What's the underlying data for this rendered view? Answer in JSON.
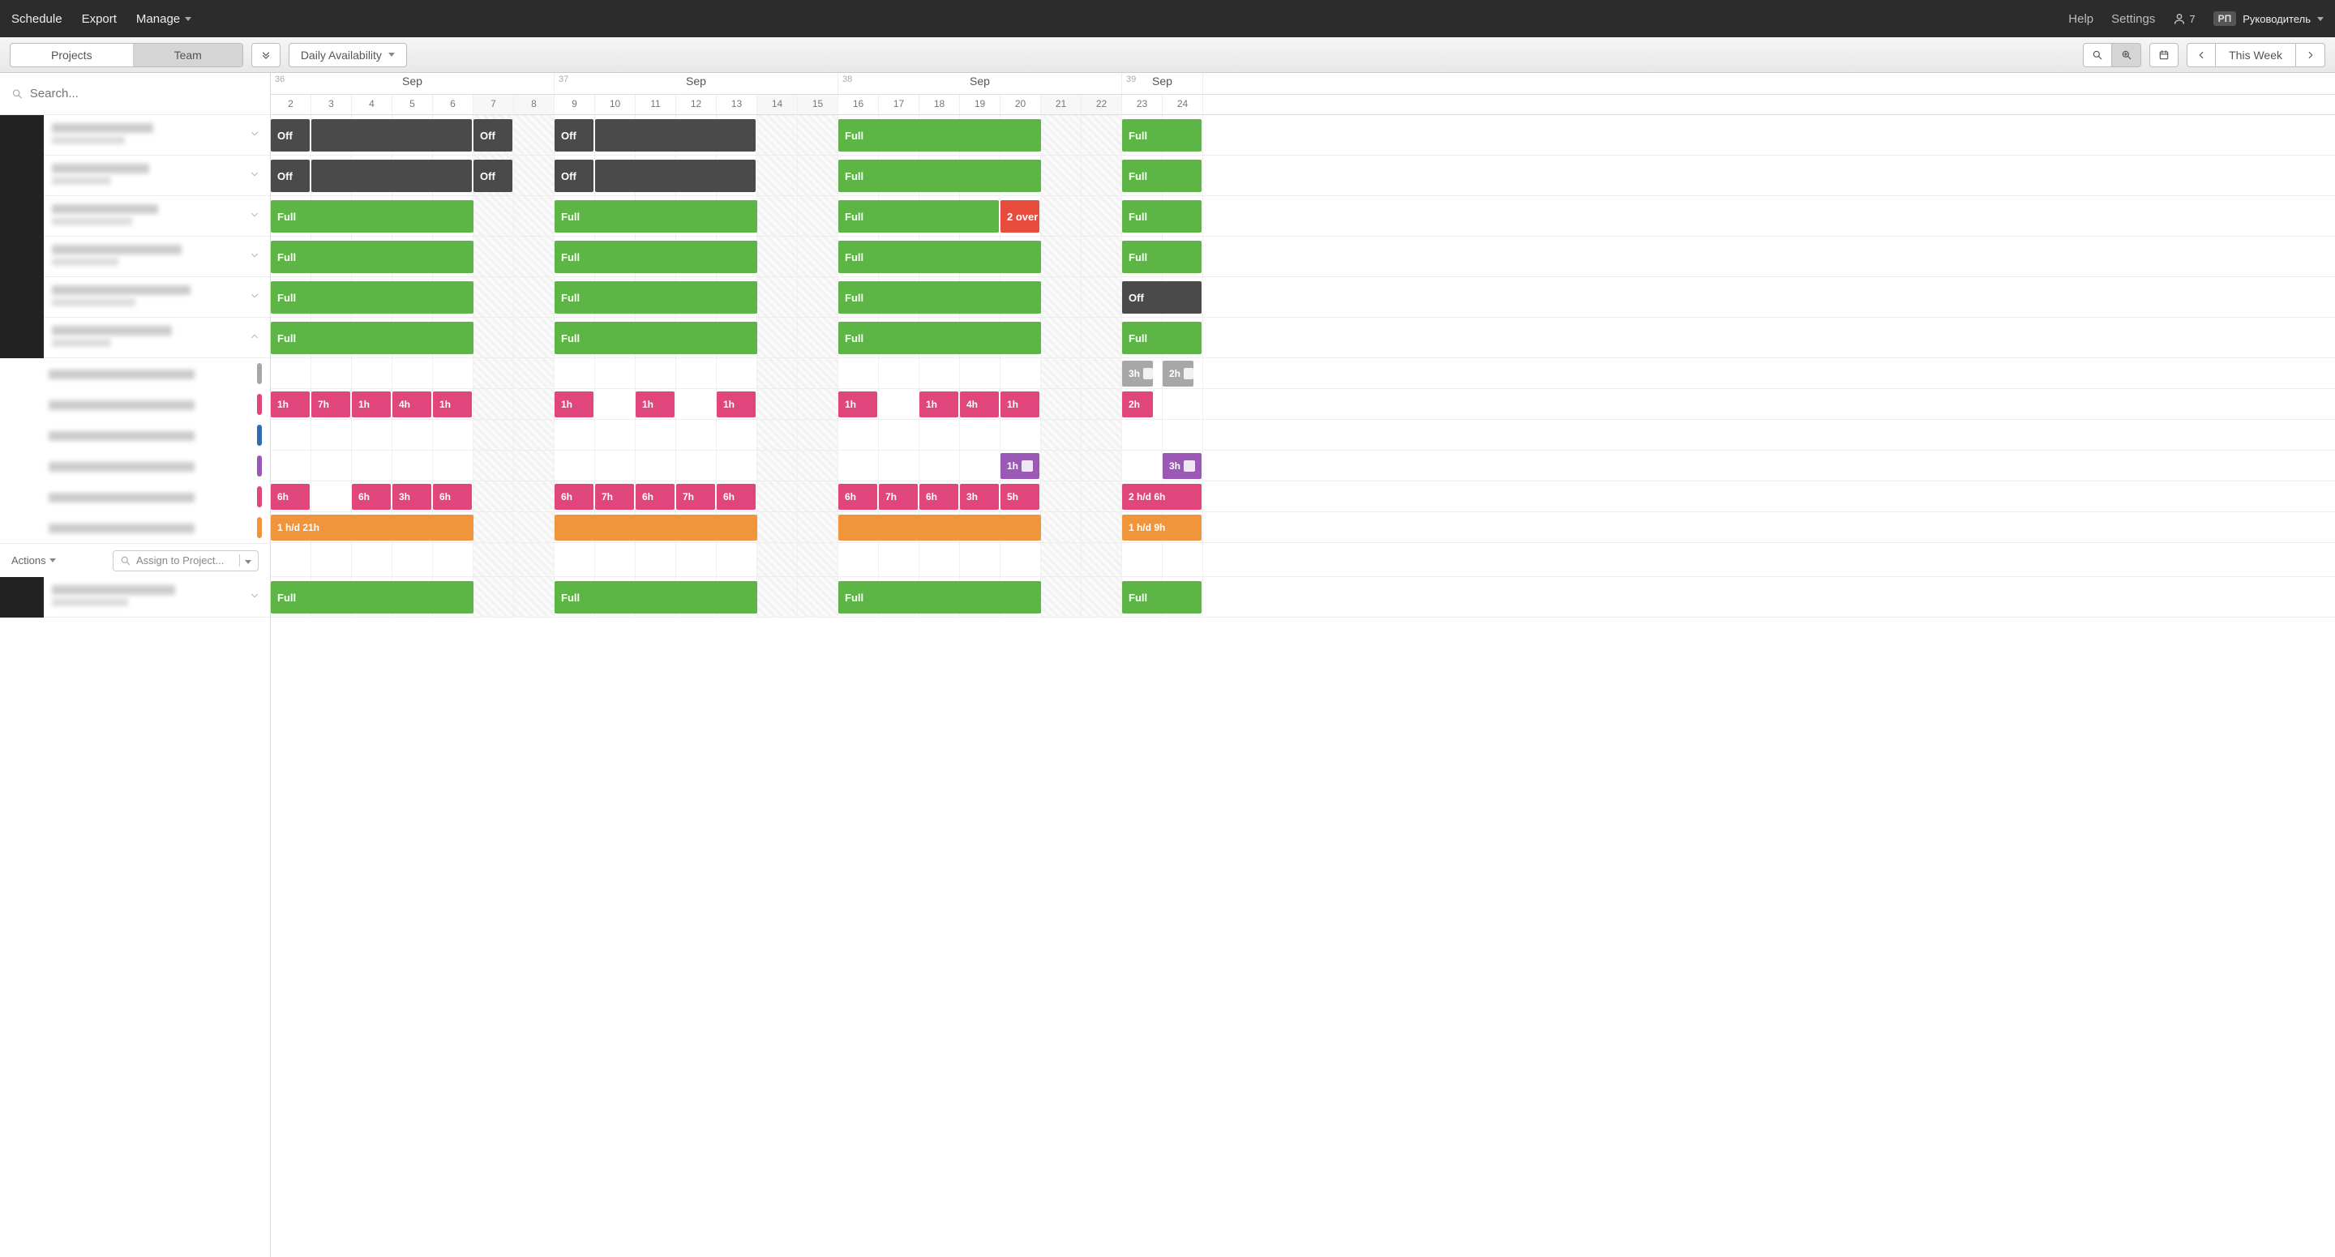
{
  "topbar": {
    "schedule": "Schedule",
    "export": "Export",
    "manage": "Manage",
    "help": "Help",
    "settings": "Settings",
    "user_count": "7",
    "user_badge": "РП",
    "user_name": "Руководитель"
  },
  "toolbar": {
    "tab_projects": "Projects",
    "tab_team": "Team",
    "availability": "Daily Availability",
    "this_week": "This Week"
  },
  "search": {
    "placeholder": "Search..."
  },
  "actions": {
    "label": "Actions",
    "assign_placeholder": "Assign to Project..."
  },
  "weeks": [
    {
      "num": "36",
      "month": "Sep",
      "days": [
        "2",
        "3",
        "4",
        "5",
        "6",
        "7",
        "8"
      ],
      "wkend_idx": [
        5,
        6
      ]
    },
    {
      "num": "37",
      "month": "Sep",
      "days": [
        "9",
        "10",
        "11",
        "12",
        "13",
        "14",
        "15"
      ],
      "wkend_idx": [
        5,
        6
      ]
    },
    {
      "num": "38",
      "month": "Sep",
      "days": [
        "16",
        "17",
        "18",
        "19",
        "20",
        "21",
        "22"
      ],
      "wkend_idx": [
        5,
        6
      ]
    },
    {
      "num": "39",
      "month": "Sep",
      "days": [
        "23",
        "24"
      ],
      "wkend_idx": []
    }
  ],
  "labels": {
    "off": "Off",
    "full": "Full",
    "over2": "2 over",
    "1h": "1h",
    "2h": "2h",
    "3h": "3h",
    "4h": "4h",
    "5h": "5h",
    "6h": "6h",
    "7h": "7h",
    "1hd21": "1 h/d  21h",
    "1hd9": "1 h/d  9h",
    "2hd6": "2 h/d  6h"
  },
  "colors": {
    "gray": "#4a4a4a",
    "green": "#5cb544",
    "red": "#e74c3c",
    "pink": "#e0457b",
    "orange": "#f0953b",
    "purple": "#9b59b6",
    "blue": "#2f6db3",
    "lightgray": "#a7a7a7"
  },
  "rows": [
    {
      "type": "person",
      "bars": [
        {
          "start": 0,
          "span": 1,
          "cls": "gray",
          "text": "off"
        },
        {
          "start": 5,
          "span": 1,
          "cls": "gray",
          "text": "off"
        },
        {
          "start": 7,
          "span": 1,
          "cls": "gray",
          "text": "off"
        },
        {
          "start": 1,
          "span": 4,
          "cls": "gray",
          "text": ""
        },
        {
          "start": 8,
          "span": 4,
          "cls": "gray",
          "text": ""
        },
        {
          "start": 14,
          "span": 5,
          "cls": "green",
          "text": "full"
        },
        {
          "start": 21,
          "span": 2,
          "cls": "green",
          "text": "full"
        }
      ]
    },
    {
      "type": "person",
      "bars": [
        {
          "start": 0,
          "span": 1,
          "cls": "gray",
          "text": "off"
        },
        {
          "start": 5,
          "span": 1,
          "cls": "gray",
          "text": "off"
        },
        {
          "start": 7,
          "span": 1,
          "cls": "gray",
          "text": "off"
        },
        {
          "start": 1,
          "span": 4,
          "cls": "gray",
          "text": ""
        },
        {
          "start": 8,
          "span": 4,
          "cls": "gray",
          "text": ""
        },
        {
          "start": 14,
          "span": 5,
          "cls": "green",
          "text": "full"
        },
        {
          "start": 21,
          "span": 2,
          "cls": "green",
          "text": "full"
        }
      ]
    },
    {
      "type": "person",
      "bars": [
        {
          "start": 0,
          "span": 5,
          "cls": "green",
          "text": "full"
        },
        {
          "start": 7,
          "span": 5,
          "cls": "green",
          "text": "full"
        },
        {
          "start": 14,
          "span": 4,
          "cls": "green",
          "text": "full"
        },
        {
          "start": 18,
          "span": 1,
          "cls": "red",
          "text": "over2"
        },
        {
          "start": 21,
          "span": 2,
          "cls": "green",
          "text": "full"
        }
      ]
    },
    {
      "type": "person",
      "bars": [
        {
          "start": 0,
          "span": 5,
          "cls": "green",
          "text": "full"
        },
        {
          "start": 7,
          "span": 5,
          "cls": "green",
          "text": "full"
        },
        {
          "start": 14,
          "span": 5,
          "cls": "green",
          "text": "full"
        },
        {
          "start": 21,
          "span": 2,
          "cls": "green",
          "text": "full"
        }
      ]
    },
    {
      "type": "person",
      "bars": [
        {
          "start": 0,
          "span": 5,
          "cls": "green",
          "text": "full"
        },
        {
          "start": 7,
          "span": 5,
          "cls": "green",
          "text": "full"
        },
        {
          "start": 14,
          "span": 5,
          "cls": "green",
          "text": "full"
        },
        {
          "start": 21,
          "span": 2,
          "cls": "gray",
          "text": "off"
        }
      ]
    },
    {
      "type": "person_expanded",
      "bars": [
        {
          "start": 0,
          "span": 5,
          "cls": "green",
          "text": "full"
        },
        {
          "start": 7,
          "span": 5,
          "cls": "green",
          "text": "full"
        },
        {
          "start": 14,
          "span": 5,
          "cls": "green",
          "text": "full"
        },
        {
          "start": 21,
          "span": 2,
          "cls": "green",
          "text": "full"
        }
      ]
    },
    {
      "type": "sub",
      "pill": "lightgray",
      "bars": [
        {
          "start": 21,
          "span": 0.8,
          "cls": "lightgray",
          "text": "3h",
          "note": true
        },
        {
          "start": 22,
          "span": 0.8,
          "cls": "lightgray",
          "text": "2h",
          "note": true
        }
      ]
    },
    {
      "type": "sub",
      "pill": "pink",
      "bars": [
        {
          "start": 0,
          "span": 1,
          "cls": "pink",
          "text": "1h"
        },
        {
          "start": 1,
          "span": 1,
          "cls": "pink",
          "text": "7h"
        },
        {
          "start": 2,
          "span": 1,
          "cls": "pink",
          "text": "1h"
        },
        {
          "start": 3,
          "span": 1,
          "cls": "pink",
          "text": "4h"
        },
        {
          "start": 4,
          "span": 1,
          "cls": "pink",
          "text": "1h"
        },
        {
          "start": 7,
          "span": 1,
          "cls": "pink",
          "text": "1h"
        },
        {
          "start": 9,
          "span": 1,
          "cls": "pink",
          "text": "1h"
        },
        {
          "start": 11,
          "span": 1,
          "cls": "pink",
          "text": "1h"
        },
        {
          "start": 14,
          "span": 1,
          "cls": "pink",
          "text": "1h"
        },
        {
          "start": 16,
          "span": 1,
          "cls": "pink",
          "text": "1h"
        },
        {
          "start": 17,
          "span": 1,
          "cls": "pink",
          "text": "4h"
        },
        {
          "start": 18,
          "span": 1,
          "cls": "pink",
          "text": "1h"
        },
        {
          "start": 21,
          "span": 0.8,
          "cls": "pink",
          "text": "2h"
        }
      ]
    },
    {
      "type": "sub",
      "pill": "blue",
      "bars": []
    },
    {
      "type": "sub",
      "pill": "purple",
      "bars": [
        {
          "start": 18,
          "span": 1,
          "cls": "purple",
          "text": "1h",
          "note": true
        },
        {
          "start": 22,
          "span": 1,
          "cls": "purple",
          "text": "3h",
          "note": true
        }
      ]
    },
    {
      "type": "sub",
      "pill": "pink",
      "bars": [
        {
          "start": 0,
          "span": 1,
          "cls": "pink",
          "text": "6h"
        },
        {
          "start": 2,
          "span": 1,
          "cls": "pink",
          "text": "6h"
        },
        {
          "start": 3,
          "span": 1,
          "cls": "pink",
          "text": "3h"
        },
        {
          "start": 4,
          "span": 1,
          "cls": "pink",
          "text": "6h"
        },
        {
          "start": 7,
          "span": 1,
          "cls": "pink",
          "text": "6h"
        },
        {
          "start": 8,
          "span": 1,
          "cls": "pink",
          "text": "7h"
        },
        {
          "start": 9,
          "span": 1,
          "cls": "pink",
          "text": "6h"
        },
        {
          "start": 10,
          "span": 1,
          "cls": "pink",
          "text": "7h"
        },
        {
          "start": 11,
          "span": 1,
          "cls": "pink",
          "text": "6h"
        },
        {
          "start": 14,
          "span": 1,
          "cls": "pink",
          "text": "6h"
        },
        {
          "start": 15,
          "span": 1,
          "cls": "pink",
          "text": "7h"
        },
        {
          "start": 16,
          "span": 1,
          "cls": "pink",
          "text": "6h"
        },
        {
          "start": 17,
          "span": 1,
          "cls": "pink",
          "text": "3h"
        },
        {
          "start": 18,
          "span": 1,
          "cls": "pink",
          "text": "5h"
        },
        {
          "start": 21,
          "span": 2,
          "cls": "pink",
          "text": "2hd6"
        }
      ]
    },
    {
      "type": "sub",
      "pill": "orange",
      "bars": [
        {
          "start": 0,
          "span": 5,
          "cls": "orange",
          "text": "1hd21"
        },
        {
          "start": 7,
          "span": 5,
          "cls": "orange",
          "text": ""
        },
        {
          "start": 14,
          "span": 5,
          "cls": "orange",
          "text": ""
        },
        {
          "start": 21,
          "span": 2,
          "cls": "orange",
          "text": "1hd9"
        }
      ]
    },
    {
      "type": "actions"
    },
    {
      "type": "person",
      "bars": [
        {
          "start": 0,
          "span": 5,
          "cls": "green",
          "text": "full"
        },
        {
          "start": 7,
          "span": 5,
          "cls": "green",
          "text": "full"
        },
        {
          "start": 14,
          "span": 5,
          "cls": "green",
          "text": "full"
        },
        {
          "start": 21,
          "span": 2,
          "cls": "green",
          "text": "full"
        }
      ]
    }
  ]
}
